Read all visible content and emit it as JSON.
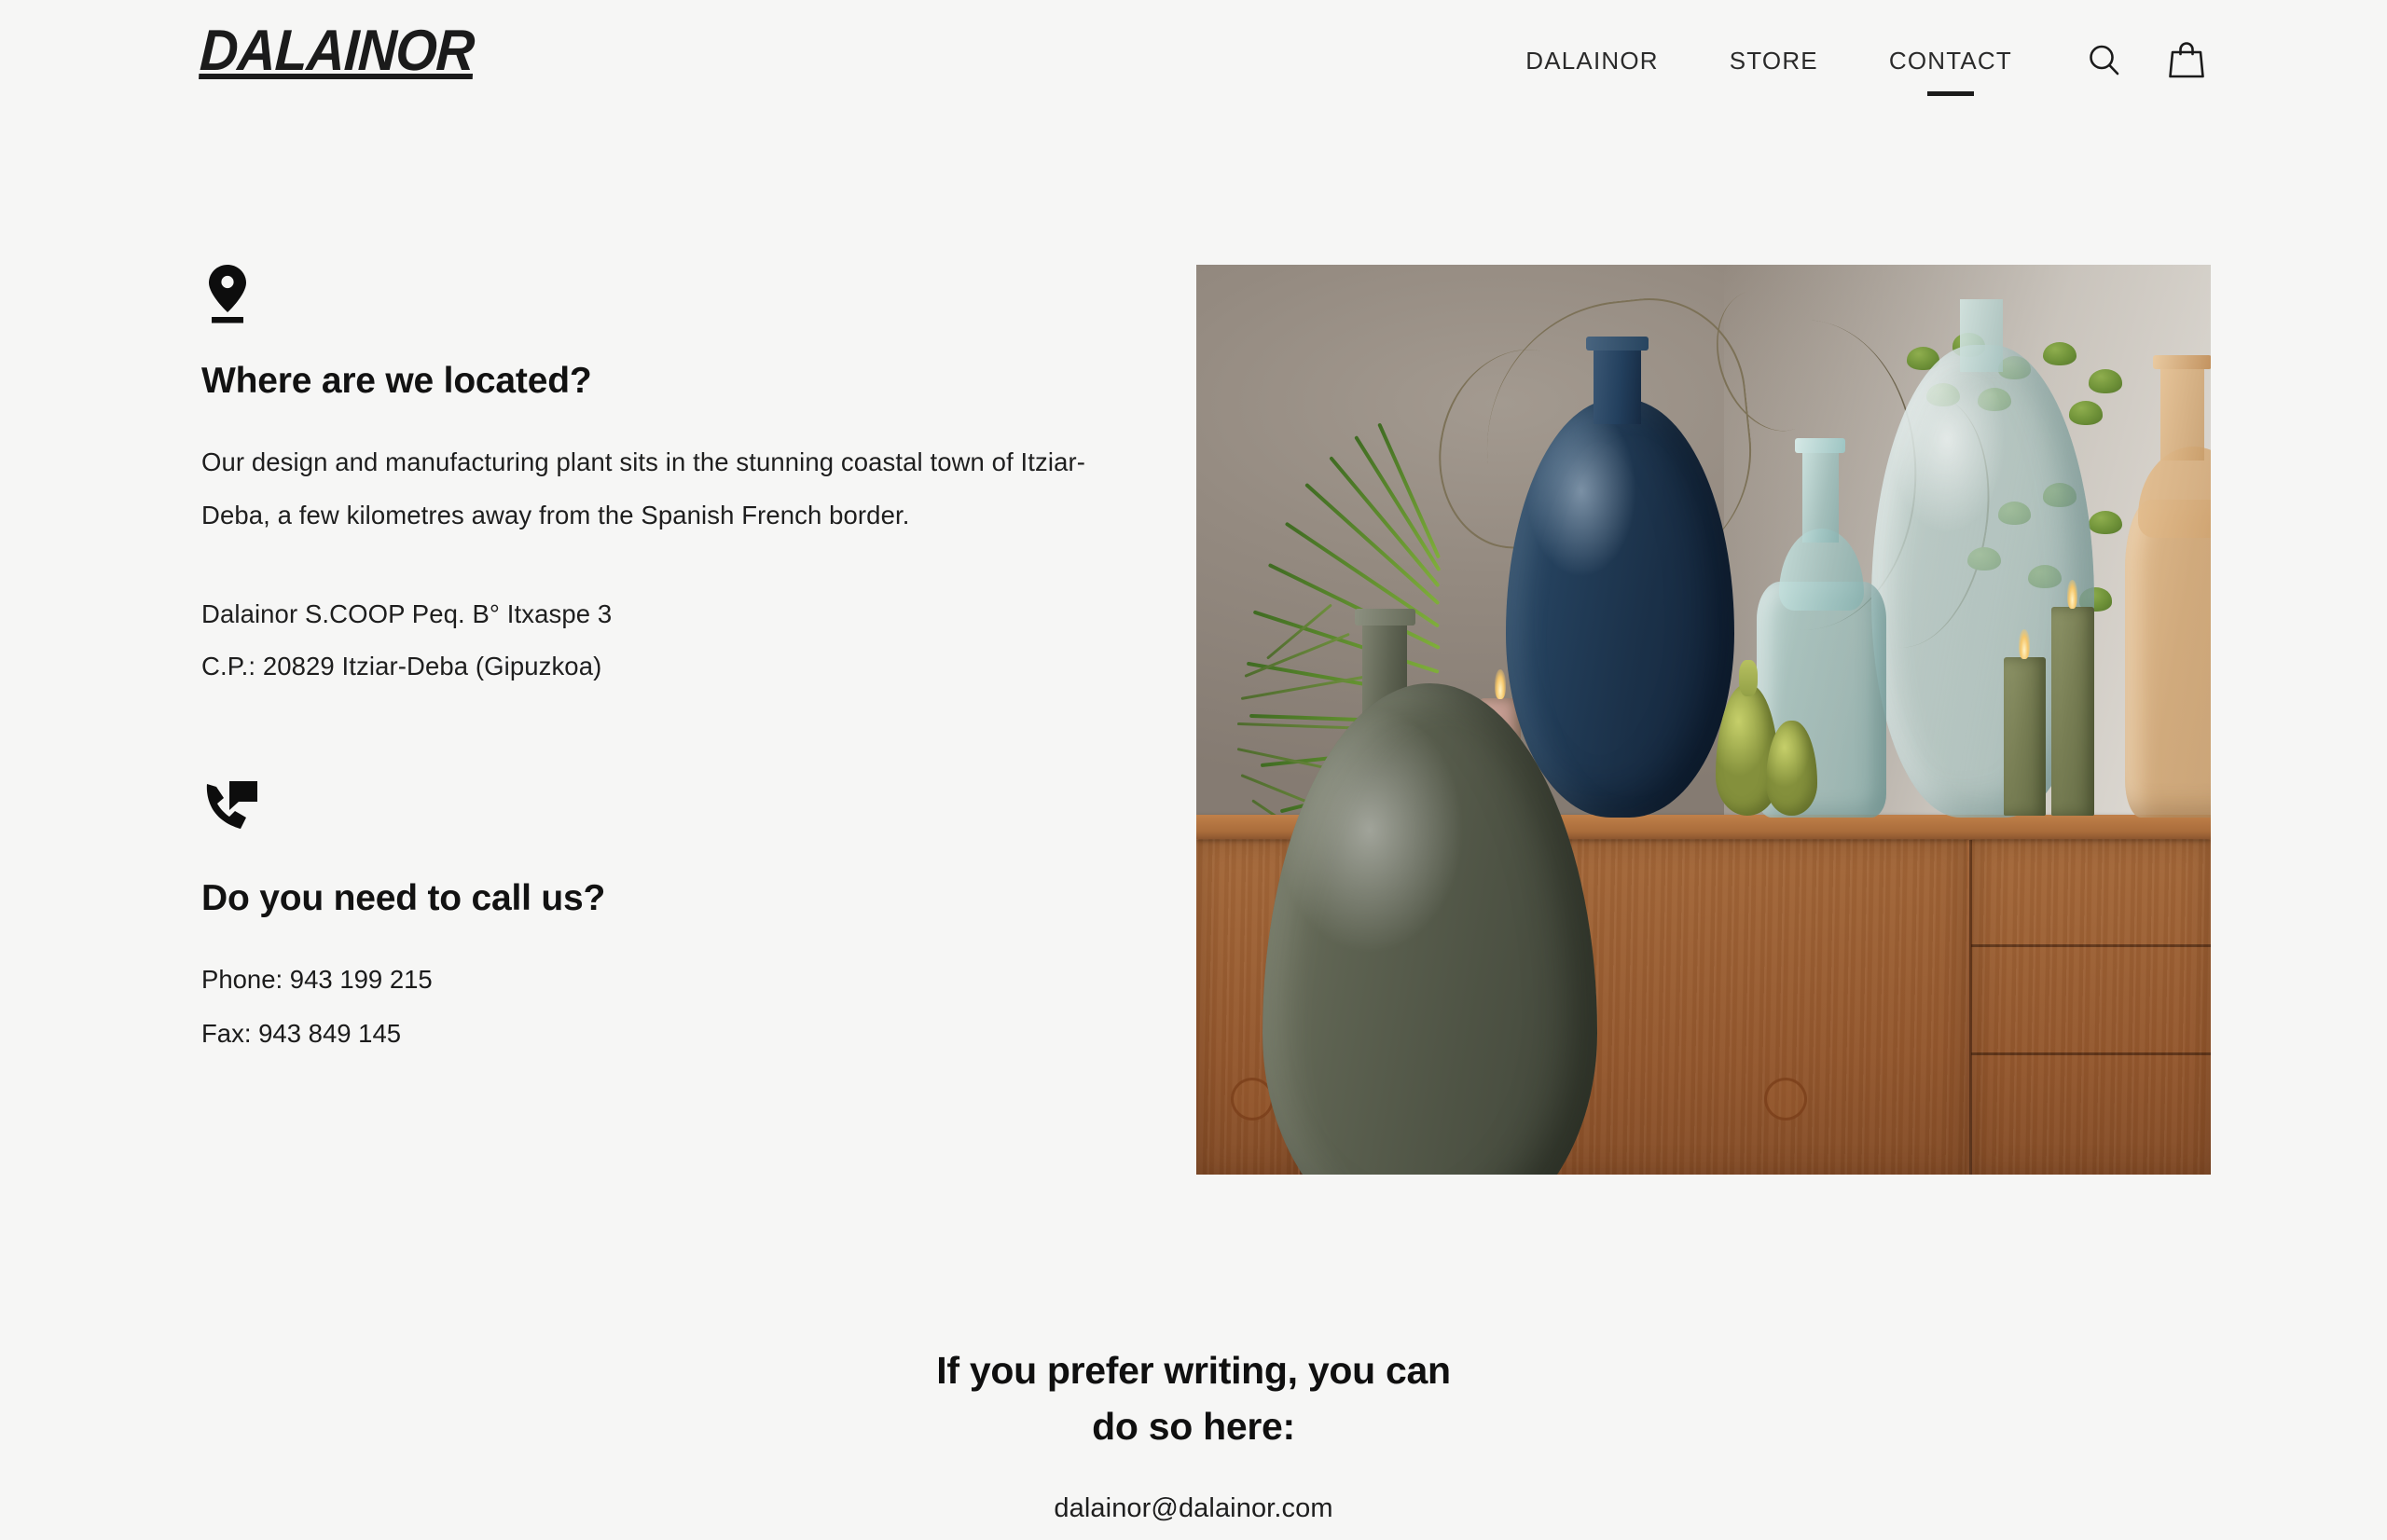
{
  "site": {
    "brand": "DALAINOR",
    "background_color": "#f6f6f5",
    "text_color": "#1b1b1b"
  },
  "header": {
    "nav": [
      {
        "label": "DALAINOR",
        "active": false
      },
      {
        "label": "STORE",
        "active": false
      },
      {
        "label": "CONTACT",
        "active": true
      }
    ],
    "icons": [
      {
        "name": "search-icon",
        "label": "Search"
      },
      {
        "name": "shopping-bag-icon",
        "label": "Cart"
      }
    ]
  },
  "contact": {
    "location": {
      "icon": "location-pin-icon",
      "title": "Where are we located?",
      "paragraph": "Our design and manufacturing plant sits in the stunning coastal town of Itziar-Deba, a few kilometres away from the Spanish French border.",
      "address_lines": [
        "Dalainor S.COOP Peq. B° Itxaspe 3",
        "C.P.: 20829 Itziar-Deba (Gipuzkoa)"
      ]
    },
    "phone": {
      "icon": "phone-in-talk-icon",
      "title": "Do you need to call us?",
      "lines": [
        "Phone: 943 199 215",
        "Fax: 943 849 145"
      ]
    }
  },
  "photo": {
    "alt": "Glass demijohn vases, pears and candles on a wooden sideboard",
    "elements": [
      "olive-green demijohn vase",
      "navy blue demijohn vase",
      "pale aqua glass bottle",
      "large pale green demijohn",
      "amber glass bottle",
      "two green pears",
      "two olive pillar candles",
      "pink pillar candle",
      "palm frond",
      "fern",
      "twisted willow branches with green leaves",
      "oak sideboard"
    ]
  },
  "writing": {
    "heading_line_1": "If you prefer writing, you can",
    "heading_line_2": "do so here:",
    "email": "dalainor@dalainor.com"
  }
}
